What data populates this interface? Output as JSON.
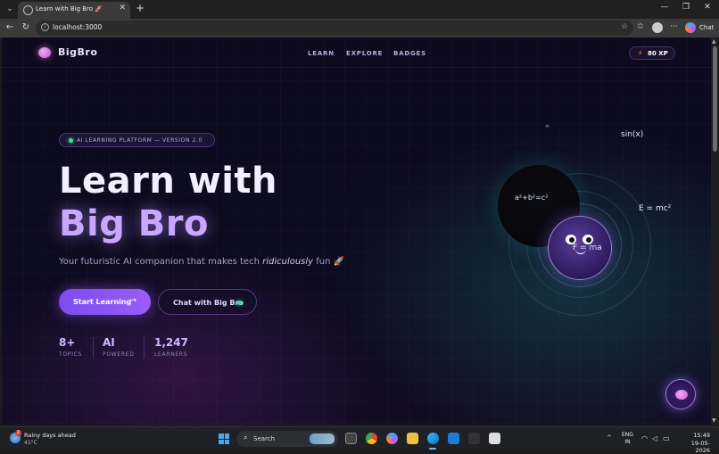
{
  "browser": {
    "tab_title": "Learn with Big Bro 🚀",
    "tab_close": "✕",
    "new_tab": "+",
    "url": "localhost:3000",
    "window_controls": {
      "minimize": "—",
      "maximize": "❐",
      "close": "✕"
    },
    "nav": {
      "back": "←",
      "reload": "↻"
    },
    "toolbar_icons": {
      "star": "☆",
      "favorites": "✩",
      "more": "···"
    },
    "chat_label": "Chat"
  },
  "site": {
    "logo_text": "BigBro",
    "nav": [
      "LEARN",
      "EXPLORE",
      "BADGES"
    ],
    "xp": "80 XP",
    "xp_icon": "bolt-icon"
  },
  "hero": {
    "badge": "AI LEARNING PLATFORM — VERSION 2.0",
    "title_line1": "Learn with",
    "title_line2": "Big Bro",
    "subtitle_before": "Your futuristic AI companion that makes tech ",
    "subtitle_em": "ridiculously",
    "subtitle_after": " fun 🚀",
    "primary_button": "Start Learning",
    "primary_arrow": "→",
    "secondary_button": "Chat with Big Bro",
    "stats": [
      {
        "value": "8+",
        "label": "TOPICS"
      },
      {
        "value": "AI",
        "label": "POWERED"
      },
      {
        "value": "1,247",
        "label": "LEARNERS"
      }
    ]
  },
  "visual": {
    "formula_pythagoras": "a²+b²=c²",
    "formula_force": "F = ma",
    "formula_energy": "E = mc²",
    "formula_sin": "sin(x)",
    "infinity": "∞"
  },
  "taskbar": {
    "weather_title": "Rainy days ahead",
    "weather_temp": "41°C",
    "weather_badge": "2",
    "search_label": "Search",
    "lang_line1": "ENG",
    "lang_line2": "IN",
    "time": "15:49",
    "date": "19-05-2026"
  },
  "colors": {
    "accent": "#8b5cf6",
    "heading_gradient": "#c9a6ff",
    "status_dot": "#34e0a0",
    "xp_bolt": "#ff9a3c"
  }
}
